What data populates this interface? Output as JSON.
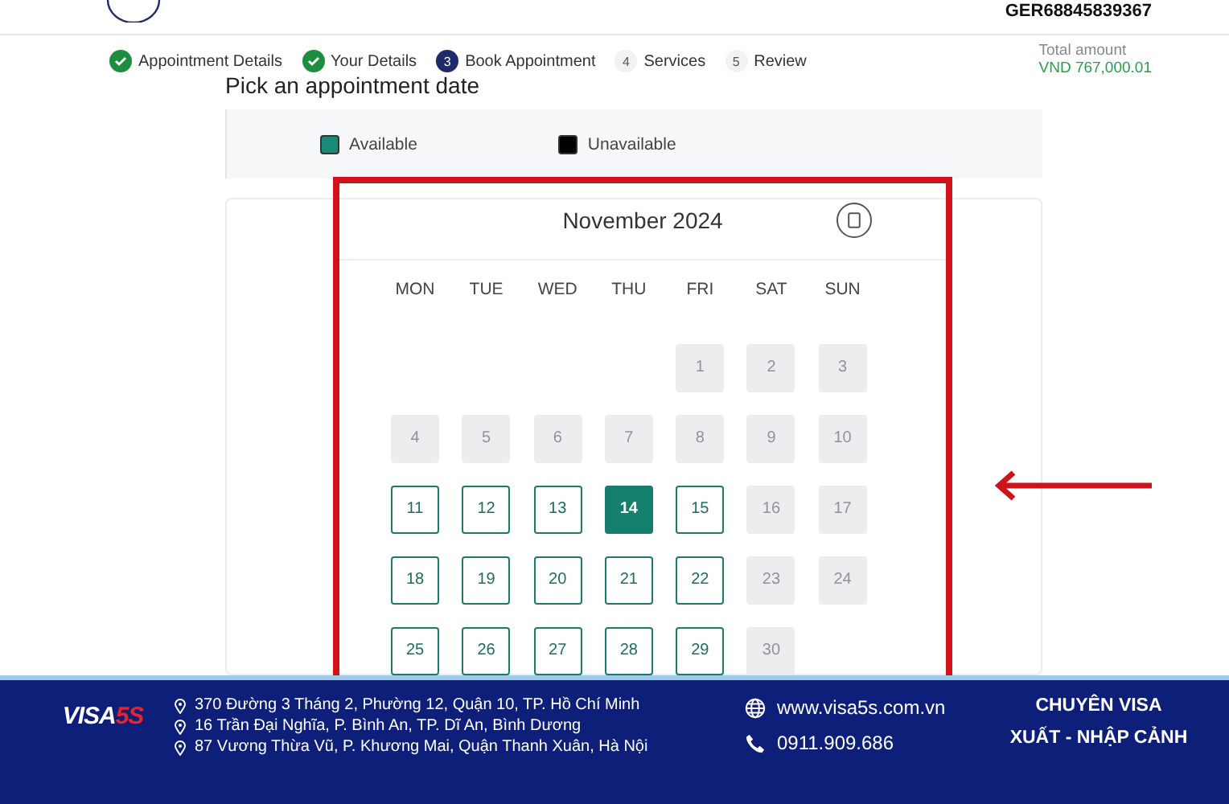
{
  "header": {
    "reference": "GER68845839367"
  },
  "steps": [
    {
      "label": "Appointment Details",
      "kind": "done"
    },
    {
      "label": "Your Details",
      "kind": "done"
    },
    {
      "label": "Book Appointment",
      "kind": "current",
      "number": "3"
    },
    {
      "label": "Services",
      "kind": "todo",
      "number": "4"
    },
    {
      "label": "Review",
      "kind": "todo",
      "number": "5"
    }
  ],
  "total": {
    "label": "Total amount",
    "value": "VND 767,000.01"
  },
  "page_title": "Pick an appointment date",
  "legend": [
    {
      "label": "Available",
      "kind": "available"
    },
    {
      "label": "Unavailable",
      "kind": "unavailable"
    }
  ],
  "calendar": {
    "month": "November 2024",
    "weekdays": [
      "MON",
      "TUE",
      "WED",
      "THU",
      "FRI",
      "SAT",
      "SUN"
    ],
    "weeks": [
      [
        {
          "kind": "empty"
        },
        {
          "kind": "empty"
        },
        {
          "kind": "empty"
        },
        {
          "kind": "empty"
        },
        {
          "kind": "unavailable",
          "day": "1",
          "selected": false
        },
        {
          "kind": "unavailable",
          "day": "2",
          "selected": false
        },
        {
          "kind": "unavailable",
          "day": "3",
          "selected": false
        }
      ],
      [
        {
          "kind": "unavailable",
          "day": "4",
          "selected": false
        },
        {
          "kind": "unavailable",
          "day": "5",
          "selected": false
        },
        {
          "kind": "unavailable",
          "day": "6",
          "selected": false
        },
        {
          "kind": "unavailable",
          "day": "7",
          "selected": false
        },
        {
          "kind": "unavailable",
          "day": "8",
          "selected": false
        },
        {
          "kind": "unavailable",
          "day": "9",
          "selected": false
        },
        {
          "kind": "unavailable",
          "day": "10",
          "selected": false
        }
      ],
      [
        {
          "kind": "available",
          "day": "11",
          "selected": false
        },
        {
          "kind": "available",
          "day": "12",
          "selected": false
        },
        {
          "kind": "available",
          "day": "13",
          "selected": false
        },
        {
          "kind": "available",
          "day": "14",
          "selected": true
        },
        {
          "kind": "available",
          "day": "15",
          "selected": false
        },
        {
          "kind": "unavailable",
          "day": "16",
          "selected": false
        },
        {
          "kind": "unavailable",
          "day": "17",
          "selected": false
        }
      ],
      [
        {
          "kind": "available",
          "day": "18",
          "selected": false
        },
        {
          "kind": "available",
          "day": "19",
          "selected": false
        },
        {
          "kind": "available",
          "day": "20",
          "selected": false
        },
        {
          "kind": "available",
          "day": "21",
          "selected": false
        },
        {
          "kind": "available",
          "day": "22",
          "selected": false
        },
        {
          "kind": "unavailable",
          "day": "23",
          "selected": false
        },
        {
          "kind": "unavailable",
          "day": "24",
          "selected": false
        }
      ],
      [
        {
          "kind": "available",
          "day": "25",
          "selected": false
        },
        {
          "kind": "available",
          "day": "26",
          "selected": false
        },
        {
          "kind": "available",
          "day": "27",
          "selected": false
        },
        {
          "kind": "available",
          "day": "28",
          "selected": false
        },
        {
          "kind": "available",
          "day": "29",
          "selected": false
        },
        {
          "kind": "unavailable",
          "day": "30",
          "selected": false
        },
        {
          "kind": "empty"
        }
      ]
    ]
  },
  "footer": {
    "brand": [
      "VISA",
      "5S"
    ],
    "addresses": [
      "370 Đường 3 Tháng 2, Phường 12, Quận 10, TP. Hồ Chí Minh",
      "16 Trần Đại Nghĩa, P. Bình An, TP. Dĩ An, Bình Dương",
      "87 Vương Thừa Vũ, P. Khương Mai, Quận Thanh Xuân, Hà Nội"
    ],
    "contacts": [
      {
        "kind": "web",
        "text": "www.visa5s.com.vn"
      },
      {
        "kind": "phone",
        "text": "0911.909.686"
      }
    ],
    "slogan": [
      "CHUYÊN VISA",
      "XUẤT - NHẬP CẢNH"
    ]
  }
}
